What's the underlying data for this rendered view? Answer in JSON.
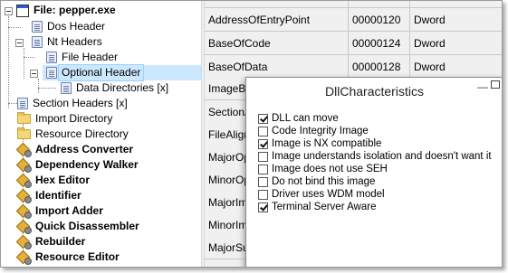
{
  "tree": {
    "root": "File: pepper.exe",
    "items": [
      {
        "label": "Dos Header",
        "icon": "document-icon"
      },
      {
        "label": "Nt Headers",
        "icon": "document-icon"
      },
      {
        "label": "File Header",
        "icon": "document-icon"
      },
      {
        "label": "Optional Header",
        "icon": "document-icon",
        "selected": true
      },
      {
        "label": "Data Directories [x]",
        "icon": "document-icon"
      },
      {
        "label": "Section Headers [x]",
        "icon": "document-icon"
      },
      {
        "label": "Import Directory",
        "icon": "folder-icon"
      },
      {
        "label": "Resource Directory",
        "icon": "folder-icon"
      }
    ],
    "tools": [
      "Address Converter",
      "Dependency Walker",
      "Hex Editor",
      "Identifier",
      "Import Adder",
      "Quick Disassembler",
      "Rebuilder",
      "Resource Editor"
    ]
  },
  "grid": {
    "rows": [
      [
        "",
        "",
        ""
      ],
      [
        "AddressOfEntryPoint",
        "00000120",
        "Dword"
      ],
      [
        "BaseOfCode",
        "00000124",
        "Dword"
      ],
      [
        "BaseOfData",
        "00000128",
        "Dword"
      ],
      [
        "ImageBase",
        "",
        ""
      ],
      [
        "SectionAlignment",
        "",
        ""
      ],
      [
        "FileAlignment",
        "",
        ""
      ],
      [
        "MajorOperatingSystemVersion",
        "",
        ""
      ],
      [
        "MinorOperatingSystemVersion",
        "",
        ""
      ],
      [
        "MajorImageVersion",
        "",
        ""
      ],
      [
        "MinorImageVersion",
        "",
        ""
      ],
      [
        "MajorSubsystemVersion",
        "",
        ""
      ]
    ]
  },
  "popup": {
    "title": "DllCharacteristics",
    "minimize": "—",
    "options": [
      {
        "label": "DLL can move",
        "checked": true
      },
      {
        "label": "Code Integrity Image",
        "checked": false
      },
      {
        "label": "Image is NX compatible",
        "checked": true
      },
      {
        "label": "Image understands isolation and doesn't want it",
        "checked": false
      },
      {
        "label": "Image does not use SEH",
        "checked": false
      },
      {
        "label": "Do not bind this image",
        "checked": false
      },
      {
        "label": "Driver uses WDM model",
        "checked": false
      },
      {
        "label": "Terminal Server Aware",
        "checked": true
      }
    ]
  }
}
